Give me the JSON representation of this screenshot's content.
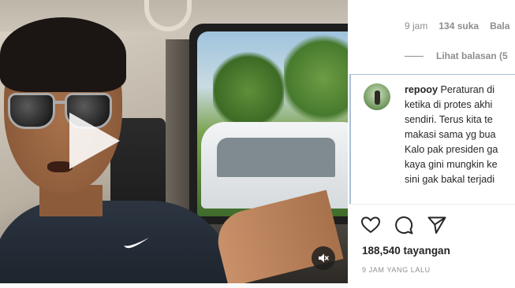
{
  "video": {
    "play_icon": "play-icon",
    "mute_icon": "speaker-muted-icon"
  },
  "post_meta": {
    "time": "9 jam",
    "likes": "134 suka",
    "reply": "Bala"
  },
  "replies": {
    "label": "Lihat balasan (5"
  },
  "comment": {
    "username": "repooy",
    "lines": [
      " Peraturan di",
      "ketika di protes akhi",
      "sendiri. Terus kita te",
      "makasi sama yg bua",
      "Kalo pak presiden ga",
      "kaya gini mungkin ke",
      "sini gak bakal terjadi"
    ]
  },
  "actions": {
    "like_icon": "heart-icon",
    "comment_icon": "comment-icon",
    "share_icon": "share-icon"
  },
  "views": "188,540 tayangan",
  "time_ago": "9 JAM YANG LALU"
}
